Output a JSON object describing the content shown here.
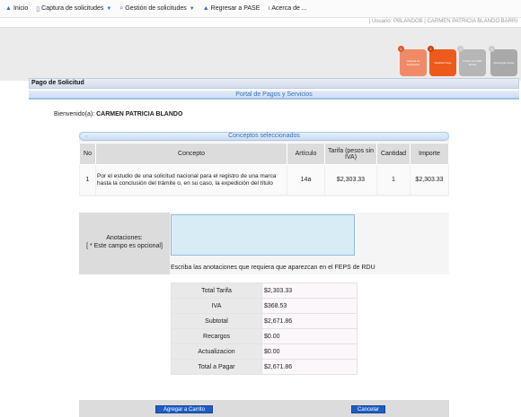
{
  "menu": [
    {
      "label": "Inicio",
      "icon": "up-arrow-icon",
      "glyph": "▲",
      "dropdown": false
    },
    {
      "label": "Captura de solicitudes",
      "icon": "document-icon",
      "glyph": "▯",
      "dropdown": true
    },
    {
      "label": "Gestión de solicitudes",
      "icon": "search-icon",
      "glyph": "⌕",
      "dropdown": true
    },
    {
      "label": "Regresar a PASE",
      "icon": "up-arrow-icon",
      "glyph": "▲",
      "dropdown": false
    },
    {
      "label": "Acerca de ...",
      "icon": "info-icon",
      "glyph": "ı",
      "dropdown": false
    }
  ],
  "user_line": "| Usuario: PBLANDOB | CARMEN PATRICIA BLANDO BARRI",
  "steps": [
    {
      "num": "1",
      "label": "Captura de Solicitudes",
      "color": "#f08a66",
      "num_color": "#e0572c"
    },
    {
      "num": "2",
      "label": "Realizar Pago",
      "color": "#ee5a1b",
      "num_color": "#c8410b"
    },
    {
      "num": "3",
      "label": "Firmar con FIEL Enviar",
      "color": "#b6b6b6",
      "num_color": "#c9c9c9"
    },
    {
      "num": "4",
      "label": "Descargar Acuse",
      "color": "#a9a9a9",
      "num_color": "#c9c9c9"
    }
  ],
  "section_title": "Pago de Solicitud",
  "portal_title": "Portal de Pagos y Servicios",
  "welcome_prefix": "Bienvenido(a):",
  "welcome_name": "CARMEN PATRICIA BLANDO",
  "concepts": {
    "title": "Conceptos seleccionados",
    "columns": [
      "No",
      "Concepto",
      "Artículo",
      "Tarifa (pesos sin IVA)",
      "Cantidad",
      "Importe"
    ],
    "rows": [
      {
        "no": "1",
        "concepto": "Por el estudio de una solicitud nacional para el registro de una marca hasta la conclusión del trámite o, en su caso, la expedición del título",
        "articulo": "14a",
        "tarifa": "$2,303.33",
        "cantidad": "1",
        "importe": "$2,303.33"
      }
    ]
  },
  "annotations": {
    "label": "Anotaciones:",
    "optional": "[ * Este campo es opcional]",
    "value": "",
    "hint": "Escriba las anotaciones que requiera que aparezcan en el FEPS de RDU"
  },
  "totals": [
    {
      "label": "Total Tarifa",
      "value": "$2,303.33"
    },
    {
      "label": "IVA",
      "value": "$368.53"
    },
    {
      "label": "Subtotal",
      "value": "$2,671.86"
    },
    {
      "label": "Recargos",
      "value": "$0.00"
    },
    {
      "label": "Actualizacion",
      "value": "$0.00"
    },
    {
      "label": "Total a Pagar",
      "value": "$2,671.86"
    }
  ],
  "buttons": {
    "add_to_cart": "Agregar a Carrito",
    "cancel": "Cancelar"
  },
  "colors": {
    "accent": "#3a6fb6",
    "button": "#1f5dc2"
  }
}
